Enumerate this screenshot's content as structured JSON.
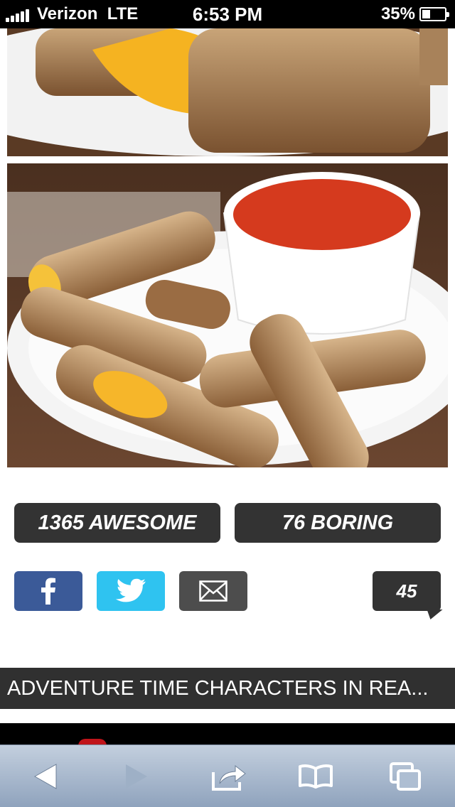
{
  "status_bar": {
    "carrier": "Verizon",
    "network": "LTE",
    "time": "6:53 PM",
    "battery": "35%",
    "battery_level": 0.35
  },
  "photos": [
    {
      "name": "grilled-cheese-roll-closeup"
    },
    {
      "name": "grilled-cheese-roll-ups-with-tomato-soup"
    }
  ],
  "votes": {
    "awesome_label": "1365 AWESOME",
    "boring_label": "76 BORING"
  },
  "share": {
    "facebook_icon": "facebook-icon",
    "twitter_icon": "twitter-icon",
    "email_icon": "envelope-icon",
    "comment_count": "45"
  },
  "next_article": {
    "title": "ADVENTURE TIME CHARACTERS IN REA..."
  },
  "toolbar": {
    "items": [
      "back-icon",
      "forward-icon",
      "share-icon",
      "bookmarks-icon",
      "tabs-icon"
    ]
  },
  "colors": {
    "facebook": "#3b5a98",
    "twitter": "#2fc3f0",
    "email": "#4d4d4d",
    "button_dark": "#333333"
  }
}
